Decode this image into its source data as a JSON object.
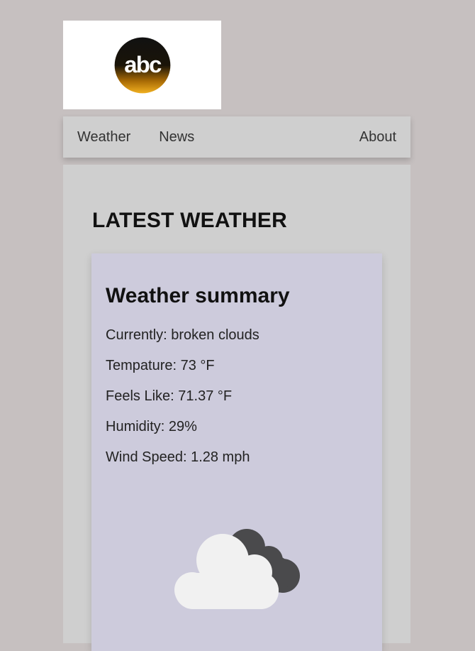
{
  "header": {
    "logo_text": "abc",
    "logo_icon": "abc-logo-icon"
  },
  "nav": {
    "items": [
      {
        "label": "Weather"
      },
      {
        "label": "News"
      }
    ],
    "about_label": "About"
  },
  "main": {
    "title": "LATEST WEATHER",
    "card": {
      "title": "Weather summary",
      "stats": [
        {
          "text": "Currently: broken clouds"
        },
        {
          "text": "Tempature: 73 °F"
        },
        {
          "text": "Feels Like: 71.37 °F"
        },
        {
          "text": "Humidity: 29%"
        },
        {
          "text": "Wind Speed: 1.28 mph"
        }
      ],
      "icon": "broken-clouds-icon"
    }
  },
  "colors": {
    "page_background": "#c6c0c0",
    "panel_background": "#cfcfcf",
    "card_background": "#cdcbdc",
    "cloud_dark": "#4a4a4c",
    "cloud_light": "#f1f1f1"
  }
}
